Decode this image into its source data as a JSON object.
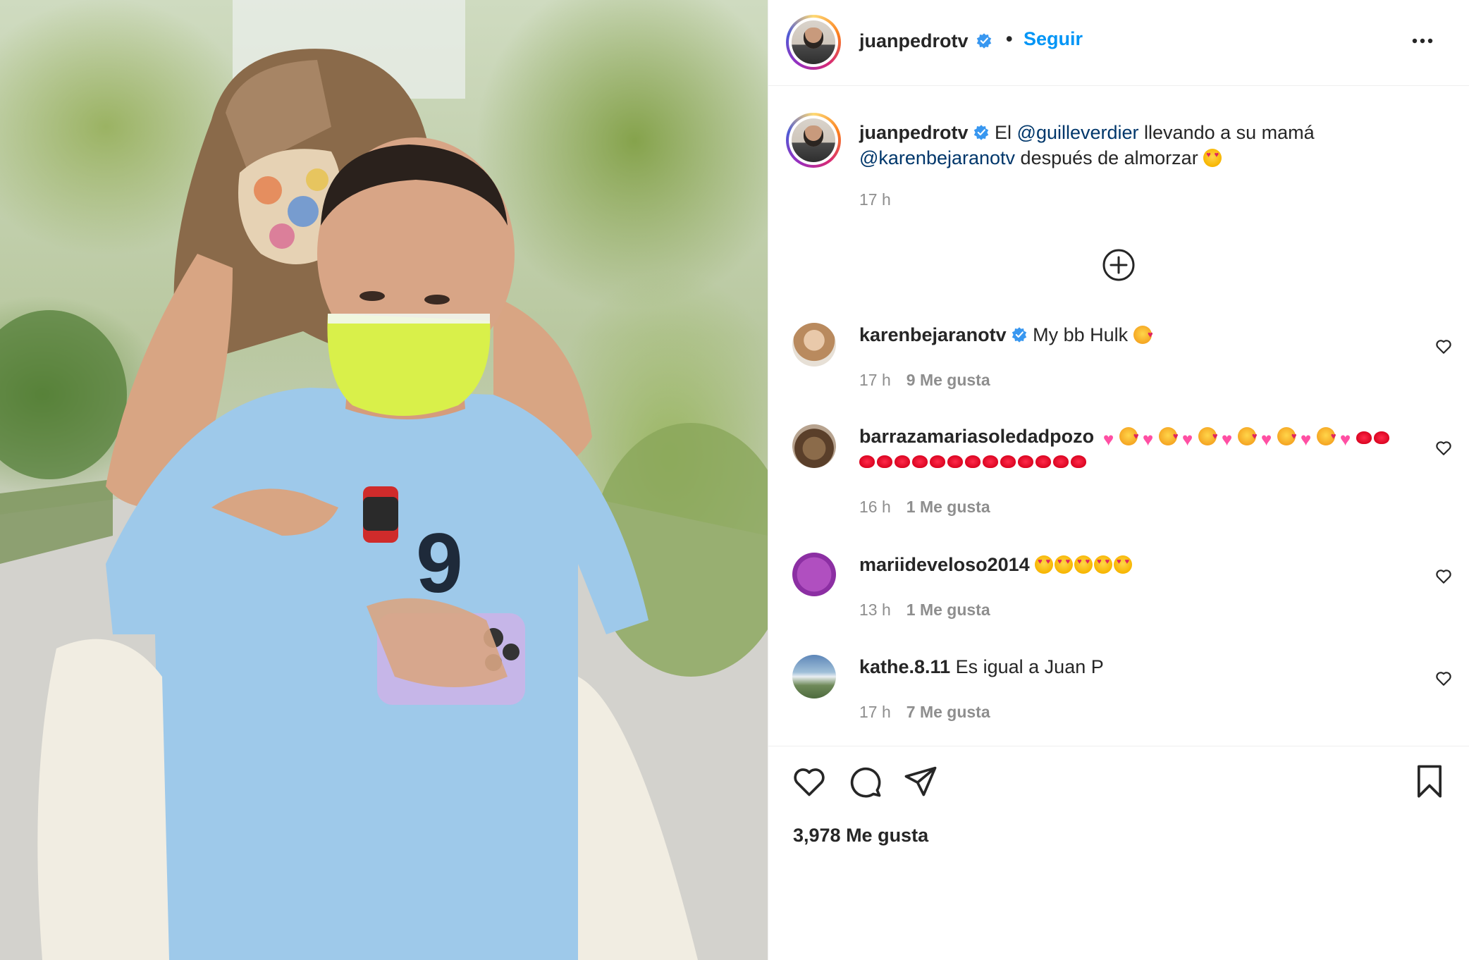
{
  "post": {
    "author": "juanpedrotv",
    "separator": "•",
    "follow_label": "Seguir",
    "caption_parts": {
      "prefix": " El ",
      "mention1": "@guilleverdier",
      "middle": " llevando a su mamá ",
      "mention2": "@karenbejaranotv",
      "suffix": " después de almorzar "
    },
    "caption_time": "17 h",
    "likes_total": "3,978 Me gusta"
  },
  "comments": [
    {
      "user": "karenbejaranotv",
      "verified": true,
      "text": "My bb Hulk ",
      "time": "17 h",
      "likes": "9 Me gusta"
    },
    {
      "user": "barrazamariasoledadpozo",
      "verified": false,
      "text": "",
      "time": "16 h",
      "likes": "1 Me gusta"
    },
    {
      "user": "mariideveloso2014",
      "verified": false,
      "text": "",
      "time": "13 h",
      "likes": "1 Me gusta"
    },
    {
      "user": "kathe.8.11",
      "verified": false,
      "text": "Es igual a Juan P",
      "time": "17 h",
      "likes": "7 Me gusta"
    }
  ],
  "icons": {
    "verified": "verified-badge-icon",
    "more": "more-options-icon",
    "add_comments": "plus-circle-icon",
    "heart": "heart-icon",
    "comment": "comment-icon",
    "share": "paper-plane-icon",
    "save": "bookmark-icon"
  },
  "colors": {
    "accent_link": "#0095f6",
    "mention": "#00376b",
    "text": "#262626",
    "muted": "#8e8e8e",
    "verified": "#3897f0"
  }
}
